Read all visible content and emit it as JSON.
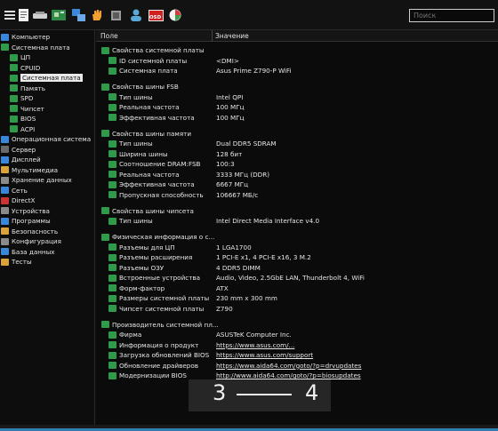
{
  "toolbar": {
    "search_placeholder": "Поиск",
    "icons": [
      "menu-icon",
      "report-icon",
      "computer-icon",
      "motherboard-icon",
      "network-icon",
      "hand-icon",
      "chip-icon",
      "user-icon",
      "osd-icon",
      "sensor-icon"
    ],
    "osd_label": "OSD"
  },
  "sidebar": {
    "items": [
      {
        "label": "Компьютер",
        "indent": 0,
        "color": "#3a86d9"
      },
      {
        "label": "Системная плата",
        "indent": 0,
        "color": "#2f9a4a"
      },
      {
        "label": "ЦП",
        "indent": 1,
        "color": "#2f9a4a"
      },
      {
        "label": "CPUID",
        "indent": 1,
        "color": "#2f9a4a"
      },
      {
        "label": "Системная плата",
        "indent": 1,
        "color": "#2f9a4a",
        "selected": true
      },
      {
        "label": "Память",
        "indent": 1,
        "color": "#2f9a4a"
      },
      {
        "label": "SPD",
        "indent": 1,
        "color": "#2f9a4a"
      },
      {
        "label": "Чипсет",
        "indent": 1,
        "color": "#2f9a4a"
      },
      {
        "label": "BIOS",
        "indent": 1,
        "color": "#2f9a4a"
      },
      {
        "label": "ACPI",
        "indent": 1,
        "color": "#2f9a4a"
      },
      {
        "label": "Операционная система",
        "indent": 0,
        "color": "#3a86d9"
      },
      {
        "label": "Сервер",
        "indent": 0,
        "color": "#6a6a6a"
      },
      {
        "label": "Дисплей",
        "indent": 0,
        "color": "#3a86d9"
      },
      {
        "label": "Мультимедиа",
        "indent": 0,
        "color": "#d9a23a"
      },
      {
        "label": "Хранение данных",
        "indent": 0,
        "color": "#8a8a8a"
      },
      {
        "label": "Сеть",
        "indent": 0,
        "color": "#3a86d9"
      },
      {
        "label": "DirectX",
        "indent": 0,
        "color": "#cc3333"
      },
      {
        "label": "Устройства",
        "indent": 0,
        "color": "#8a8a8a"
      },
      {
        "label": "Программы",
        "indent": 0,
        "color": "#3a86d9"
      },
      {
        "label": "Безопасность",
        "indent": 0,
        "color": "#d9a23a"
      },
      {
        "label": "Конфигурация",
        "indent": 0,
        "color": "#8a8a8a"
      },
      {
        "label": "База данных",
        "indent": 0,
        "color": "#3a86d9"
      },
      {
        "label": "Тесты",
        "indent": 0,
        "color": "#d9a23a"
      }
    ]
  },
  "table": {
    "col_field": "Поле",
    "col_value": "Значение",
    "rows": [
      {
        "type": "section",
        "field": "Свойства системной платы",
        "value": ""
      },
      {
        "type": "item",
        "field": "ID системной платы",
        "value": "<DMI>"
      },
      {
        "type": "item",
        "field": "Системная плата",
        "value": "Asus Prime Z790-P WiFi"
      },
      {
        "type": "blank"
      },
      {
        "type": "section",
        "field": "Свойства шины FSB",
        "value": ""
      },
      {
        "type": "item",
        "field": "Тип шины",
        "value": "Intel QPI"
      },
      {
        "type": "item",
        "field": "Реальная частота",
        "value": "100 МГц"
      },
      {
        "type": "item",
        "field": "Эффективная частота",
        "value": "100 МГц"
      },
      {
        "type": "blank"
      },
      {
        "type": "section",
        "field": "Свойства шины памяти",
        "value": ""
      },
      {
        "type": "item",
        "field": "Тип шины",
        "value": "Dual DDR5 SDRAM"
      },
      {
        "type": "item",
        "field": "Ширина шины",
        "value": "128 бит"
      },
      {
        "type": "item",
        "field": "Соотношение DRAM:FSB",
        "value": "100:3"
      },
      {
        "type": "item",
        "field": "Реальная частота",
        "value": "3333 МГц (DDR)"
      },
      {
        "type": "item",
        "field": "Эффективная частота",
        "value": "6667 МГц"
      },
      {
        "type": "item",
        "field": "Пропускная способность",
        "value": "106667 МБ/с"
      },
      {
        "type": "blank"
      },
      {
        "type": "section",
        "field": "Свойства шины чипсета",
        "value": ""
      },
      {
        "type": "item",
        "field": "Тип шины",
        "value": "Intel Direct Media Interface v4.0"
      },
      {
        "type": "blank"
      },
      {
        "type": "section",
        "field": "Физическая информация о с...",
        "value": ""
      },
      {
        "type": "item",
        "field": "Разъемы для ЦП",
        "value": "1 LGA1700"
      },
      {
        "type": "item",
        "field": "Разъемы расширения",
        "value": "1 PCI-E x1, 4 PCI-E x16, 3 M.2"
      },
      {
        "type": "item",
        "field": "Разъемы ОЗУ",
        "value": "4 DDR5 DIMM"
      },
      {
        "type": "item",
        "field": "Встроенные устройства",
        "value": "Audio, Video, 2.5GbE LAN, Thunderbolt 4, WiFi"
      },
      {
        "type": "item",
        "field": "Форм-фактор",
        "value": "ATX"
      },
      {
        "type": "item",
        "field": "Размеры системной платы",
        "value": "230 mm x 300 mm"
      },
      {
        "type": "item",
        "field": "Чипсет системной платы",
        "value": "Z790"
      },
      {
        "type": "blank"
      },
      {
        "type": "section",
        "field": "Производитель системной пл...",
        "value": ""
      },
      {
        "type": "item",
        "field": "Фирма",
        "value": "ASUSTeK Computer Inc."
      },
      {
        "type": "item",
        "field": "Информация о продукт",
        "value": "https://www.asus.com/...",
        "link": true
      },
      {
        "type": "item",
        "field": "Загрузка обновлений BIOS",
        "value": "https://www.asus.com/support",
        "link": true
      },
      {
        "type": "item",
        "field": "Обновление драйверов",
        "value": "https://www.aida64.com/goto/?p=drvupdates",
        "link": true
      },
      {
        "type": "item",
        "field": "Модернизации BIOS",
        "value": "http://www.aida64.com/goto/?p=biosupdates",
        "link": true
      }
    ]
  },
  "overlay": {
    "left": "3",
    "right": "4"
  }
}
